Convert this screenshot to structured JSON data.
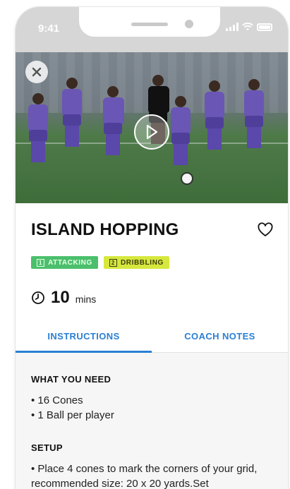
{
  "status_bar": {
    "time": "9:41"
  },
  "drill": {
    "title": "ISLAND HOPPING",
    "tags": [
      {
        "number": "1",
        "label": "ATTACKING",
        "color": "#4bbf6b"
      },
      {
        "number": "2",
        "label": "DRIBBLING",
        "color": "#d6e83d"
      }
    ],
    "duration": {
      "value": "10",
      "unit": "mins"
    }
  },
  "tabs": [
    {
      "label": "INSTRUCTIONS",
      "active": true
    },
    {
      "label": "COACH NOTES",
      "active": false
    }
  ],
  "instructions": {
    "what_you_need": {
      "heading": "WHAT YOU NEED",
      "items": [
        "16 Cones",
        "1 Ball per player"
      ]
    },
    "setup": {
      "heading": "SETUP",
      "text": "Place 4 cones to mark the corners of your grid, recommended size: 20 x 20 yards.Set"
    }
  },
  "icons": {
    "close": "close-icon",
    "play": "play-icon",
    "favorite": "heart-icon",
    "duration": "clock-icon"
  },
  "colors": {
    "accent": "#2a7fd4",
    "attacking_tag": "#4bbf6b",
    "dribbling_tag": "#d6e83d"
  }
}
